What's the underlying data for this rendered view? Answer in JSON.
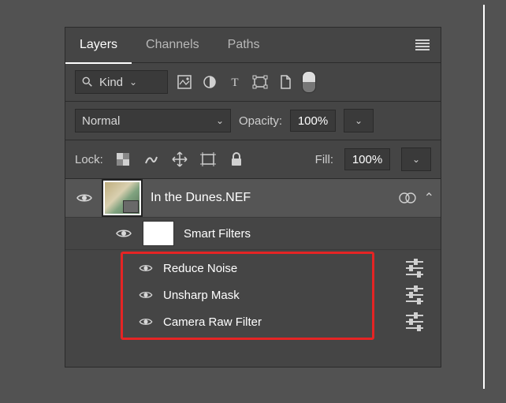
{
  "tabs": {
    "layers": "Layers",
    "channels": "Channels",
    "paths": "Paths"
  },
  "filter": {
    "kind_label": "Kind"
  },
  "blend": {
    "mode": "Normal",
    "opacity_label": "Opacity:",
    "opacity_value": "100%"
  },
  "lock": {
    "label": "Lock:",
    "fill_label": "Fill:",
    "fill_value": "100%"
  },
  "layer": {
    "name": "In the Dunes.NEF"
  },
  "smart": {
    "label": "Smart Filters"
  },
  "filters": [
    {
      "name": "Reduce Noise"
    },
    {
      "name": "Unsharp Mask"
    },
    {
      "name": "Camera Raw Filter"
    }
  ]
}
